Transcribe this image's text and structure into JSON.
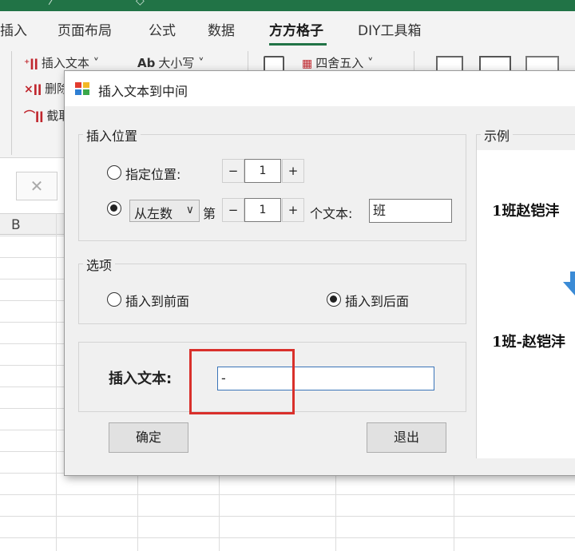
{
  "excel": {
    "tabs": [
      {
        "label": "插入"
      },
      {
        "label": "页面布局"
      },
      {
        "label": "公式"
      },
      {
        "label": "数据"
      },
      {
        "label": "方方格子",
        "active": true
      },
      {
        "label": "DIY工具箱"
      }
    ],
    "ribbon": {
      "insert_text": "插入文本 ˅",
      "case": "大小写 ˅",
      "case_icon_text": "Ab",
      "round": "四舍五入 ˅",
      "delete_partial": "删除",
      "truncate_partial": "截取"
    },
    "column_headers": [
      "B"
    ]
  },
  "dialog": {
    "title": "插入文本到中间",
    "position_group": {
      "label": "插入位置",
      "specified_position_label": "指定位置:",
      "specified_position_value": "1",
      "direction_option": "从左数",
      "nth_label": "第",
      "nth_value": "1",
      "text_label": "个文本:",
      "text_value": "班",
      "selected": "direction"
    },
    "options_group": {
      "label": "选项",
      "insert_before": "插入到前面",
      "insert_after": "插入到后面",
      "selected": "after"
    },
    "insert_text_label": "插入文本:",
    "insert_text_value": "-",
    "buttons": {
      "ok": "确定",
      "exit": "退出",
      "minus": "−",
      "plus": "+"
    },
    "example": {
      "label": "示例",
      "before": "1班赵铠沣",
      "after": "1班-赵铠沣"
    }
  },
  "colors": {
    "excel_green": "#217346",
    "highlight_red": "#d9302b",
    "arrow_blue": "#3b8bd6"
  }
}
